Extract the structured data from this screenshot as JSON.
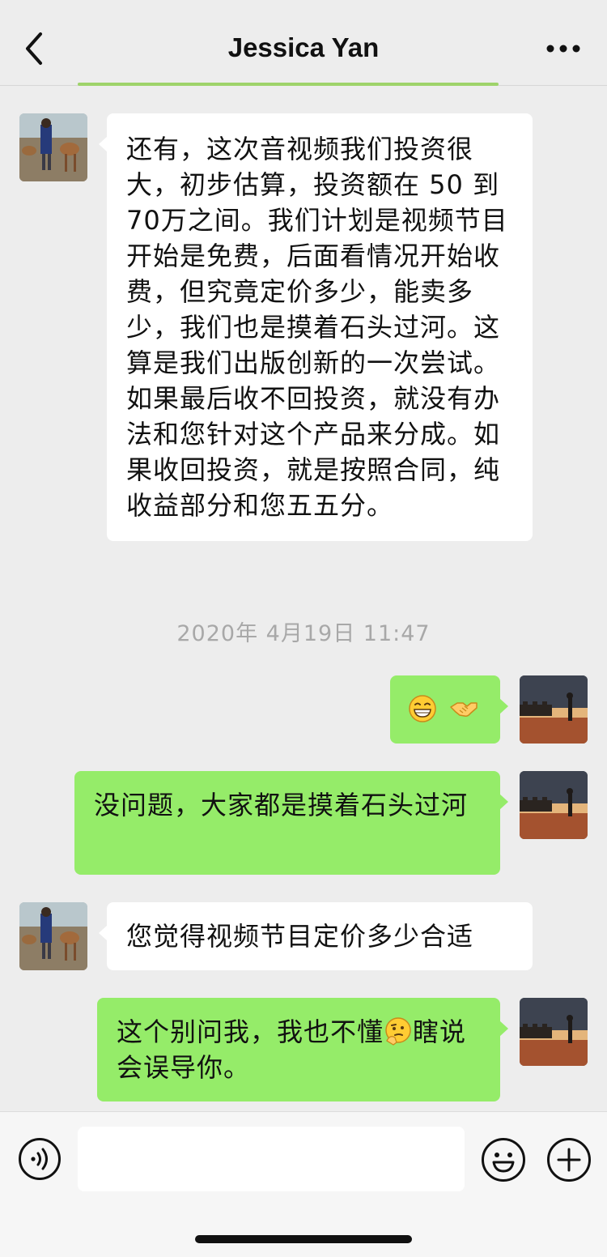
{
  "header": {
    "title": "Jessica Yan",
    "back_icon": "chevron-left-icon",
    "more_icon": "ellipsis-icon"
  },
  "messages": [
    {
      "from": "friend",
      "text": "还有，这次音视频我们投资很大，初步估算，投资额在 50 到 70万之间。我们计划是视频节目开始是免费，后面看情况开始收费，但究竟定价多少，能卖多少，我们也是摸着石头过河。这算是我们出版创新的一次尝试。如果最后收不回投资，就没有办法和您针对这个产品来分成。如果收回投资，就是按照合同，纯收益部分和您五五分。"
    },
    {
      "timestamp": "2020年 4月19日 11:47"
    },
    {
      "from": "me",
      "emojis": [
        "grinning-face-icon",
        "handshake-icon"
      ]
    },
    {
      "from": "me",
      "text": "没问题，大家都是摸着石头过河"
    },
    {
      "from": "friend",
      "text": "您觉得视频节目定价多少合适"
    },
    {
      "from": "me",
      "text_before": "这个别问我，我也不懂",
      "emoji": "thinking-face-icon",
      "text_after": "瞎说会误导你。"
    }
  ],
  "colors": {
    "background": "#ededed",
    "incoming_bubble": "#ffffff",
    "outgoing_bubble": "#95ec69",
    "timestamp": "#a8a8a8"
  },
  "input": {
    "value": "",
    "voice_icon": "voice-icon",
    "emoji_icon": "smiley-icon",
    "plus_icon": "plus-icon"
  }
}
